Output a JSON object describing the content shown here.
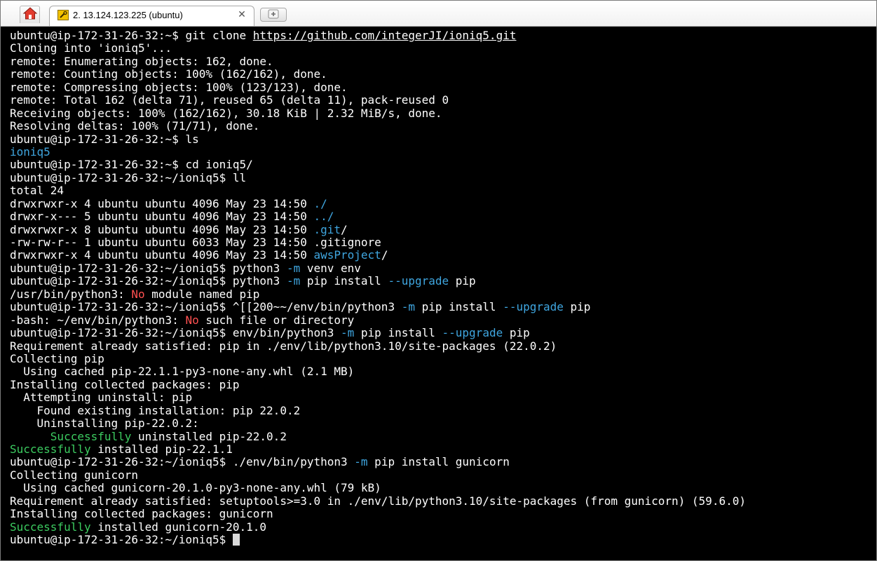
{
  "colors": {
    "background": "#000000",
    "text": "#ffffff",
    "blue": "#3fa6e0",
    "red": "#ff5050",
    "green": "#3ccc60"
  },
  "window": {
    "tab_title": "2. 13.124.123.225 (ubuntu)",
    "tab_close": "✕",
    "home_icon": "home-icon",
    "new_tab_icon": "new-tab-icon"
  },
  "terminal": {
    "lines": [
      [
        {
          "t": "ubuntu@ip-172-31-26-32:~$ git clone "
        },
        {
          "t": "https://github.com/integerJI/ioniq5.git",
          "u": true
        }
      ],
      [
        {
          "t": "Cloning into 'ioniq5'..."
        }
      ],
      [
        {
          "t": "remote: Enumerating objects: 162, done."
        }
      ],
      [
        {
          "t": "remote: Counting objects: 100% (162/162), done."
        }
      ],
      [
        {
          "t": "remote: Compressing objects: 100% (123/123), done."
        }
      ],
      [
        {
          "t": "remote: Total 162 (delta 71), reused 65 (delta 11), pack-reused 0"
        }
      ],
      [
        {
          "t": "Receiving objects: 100% (162/162), 30.18 KiB | 2.32 MiB/s, done."
        }
      ],
      [
        {
          "t": "Resolving deltas: 100% (71/71), done."
        }
      ],
      [
        {
          "t": "ubuntu@ip-172-31-26-32:~$ ls"
        }
      ],
      [
        {
          "t": "ioniq5",
          "c": "blue"
        }
      ],
      [
        {
          "t": "ubuntu@ip-172-31-26-32:~$ cd ioniq5/"
        }
      ],
      [
        {
          "t": "ubuntu@ip-172-31-26-32:~/ioniq5$ ll"
        }
      ],
      [
        {
          "t": "total 24"
        }
      ],
      [
        {
          "t": "drwxrwxr-x 4 ubuntu ubuntu 4096 May 23 14:50 "
        },
        {
          "t": "./",
          "c": "blue"
        }
      ],
      [
        {
          "t": "drwxr-x--- 5 ubuntu ubuntu 4096 May 23 14:50 "
        },
        {
          "t": "../",
          "c": "blue"
        }
      ],
      [
        {
          "t": "drwxrwxr-x 8 ubuntu ubuntu 4096 May 23 14:50 "
        },
        {
          "t": ".git",
          "c": "blue"
        },
        {
          "t": "/"
        }
      ],
      [
        {
          "t": "-rw-rw-r-- 1 ubuntu ubuntu 6033 May 23 14:50 .gitignore"
        }
      ],
      [
        {
          "t": "drwxrwxr-x 4 ubuntu ubuntu 4096 May 23 14:50 "
        },
        {
          "t": "awsProject",
          "c": "blue"
        },
        {
          "t": "/"
        }
      ],
      [
        {
          "t": "ubuntu@ip-172-31-26-32:~/ioniq5$ python3 "
        },
        {
          "t": "-m",
          "c": "blue"
        },
        {
          "t": " venv env"
        }
      ],
      [
        {
          "t": "ubuntu@ip-172-31-26-32:~/ioniq5$ python3 "
        },
        {
          "t": "-m",
          "c": "blue"
        },
        {
          "t": " pip install "
        },
        {
          "t": "--upgrade",
          "c": "blue"
        },
        {
          "t": " pip"
        }
      ],
      [
        {
          "t": "/usr/bin/python3: "
        },
        {
          "t": "No",
          "c": "red"
        },
        {
          "t": " module named pip"
        }
      ],
      [
        {
          "t": "ubuntu@ip-172-31-26-32:~/ioniq5$ ^[[200~~/env/bin/python3 "
        },
        {
          "t": "-m",
          "c": "blue"
        },
        {
          "t": " pip install "
        },
        {
          "t": "--upgrade",
          "c": "blue"
        },
        {
          "t": " pip"
        }
      ],
      [
        {
          "t": "-bash: ~/env/bin/python3: "
        },
        {
          "t": "No",
          "c": "red"
        },
        {
          "t": " such file or directory"
        }
      ],
      [
        {
          "t": "ubuntu@ip-172-31-26-32:~/ioniq5$ env/bin/python3 "
        },
        {
          "t": "-m",
          "c": "blue"
        },
        {
          "t": " pip install "
        },
        {
          "t": "--upgrade",
          "c": "blue"
        },
        {
          "t": " pip"
        }
      ],
      [
        {
          "t": "Requirement already satisfied: pip in ./env/lib/python3.10/site-packages (22.0.2)"
        }
      ],
      [
        {
          "t": "Collecting pip"
        }
      ],
      [
        {
          "t": "  Using cached pip-22.1.1-py3-none-any.whl (2.1 MB)"
        }
      ],
      [
        {
          "t": "Installing collected packages: pip"
        }
      ],
      [
        {
          "t": "  Attempting uninstall: pip"
        }
      ],
      [
        {
          "t": "    Found existing installation: pip 22.0.2"
        }
      ],
      [
        {
          "t": "    Uninstalling pip-22.0.2:"
        }
      ],
      [
        {
          "t": "      "
        },
        {
          "t": "Successfully",
          "c": "green"
        },
        {
          "t": " uninstalled pip-22.0.2"
        }
      ],
      [
        {
          "t": "Successfully",
          "c": "green"
        },
        {
          "t": " installed pip-22.1.1"
        }
      ],
      [
        {
          "t": "ubuntu@ip-172-31-26-32:~/ioniq5$ ./env/bin/python3 "
        },
        {
          "t": "-m",
          "c": "blue"
        },
        {
          "t": " pip install gunicorn"
        }
      ],
      [
        {
          "t": "Collecting gunicorn"
        }
      ],
      [
        {
          "t": "  Using cached gunicorn-20.1.0-py3-none-any.whl (79 kB)"
        }
      ],
      [
        {
          "t": "Requirement already satisfied: setuptools>=3.0 in ./env/lib/python3.10/site-packages (from gunicorn) (59.6.0)"
        }
      ],
      [
        {
          "t": "Installing collected packages: gunicorn"
        }
      ],
      [
        {
          "t": "Successfully",
          "c": "green"
        },
        {
          "t": " installed gunicorn-20.1.0"
        }
      ],
      [
        {
          "t": "ubuntu@ip-172-31-26-32:~/ioniq5$ "
        }
      ]
    ]
  }
}
